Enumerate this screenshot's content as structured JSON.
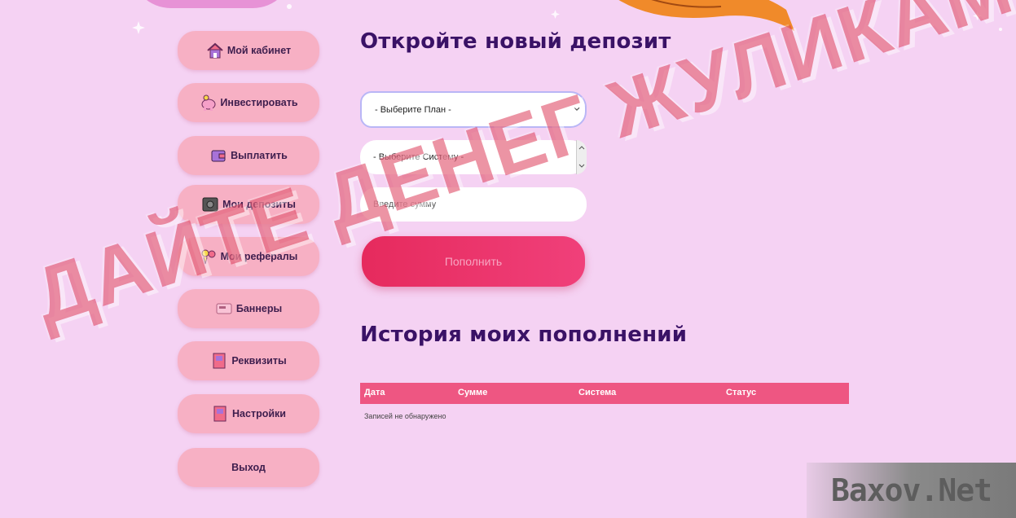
{
  "nav": {
    "items": [
      {
        "label": "Мой кабинет",
        "icon": "house-icon"
      },
      {
        "label": "Инвестировать",
        "icon": "piggy-bank-icon"
      },
      {
        "label": "Выплатить",
        "icon": "wallet-icon"
      },
      {
        "label": "Мои депозиты",
        "icon": "safe-icon"
      },
      {
        "label": "Мои рефералы",
        "icon": "people-icon"
      },
      {
        "label": "Баннеры",
        "icon": "banner-icon"
      },
      {
        "label": "Реквизиты",
        "icon": "door-icon"
      },
      {
        "label": "Настройки",
        "icon": "door-icon"
      },
      {
        "label": "Выход",
        "icon": ""
      }
    ]
  },
  "deposit": {
    "title": "Откройте новый депозит",
    "plan_select": "- Выберите План -",
    "system_select": "- Выберите Систему -",
    "amount_placeholder": "Введите сумму",
    "submit_label": "Пополнить"
  },
  "history": {
    "title": "История моих пополнений",
    "columns": [
      "Дата",
      "Сумме",
      "Система",
      "Статус"
    ],
    "empty_text": "Записей не обнаружено"
  },
  "overlay": {
    "stamp_text": "ДАЙТЕ ДЕНЕГ ЖУЛИКАМ",
    "site_watermark": "Baxov.Net"
  },
  "colors": {
    "background": "#f5d2f3",
    "nav_button": "#f7b0c4",
    "accent": "#ee5682",
    "heading": "#3a1266"
  }
}
